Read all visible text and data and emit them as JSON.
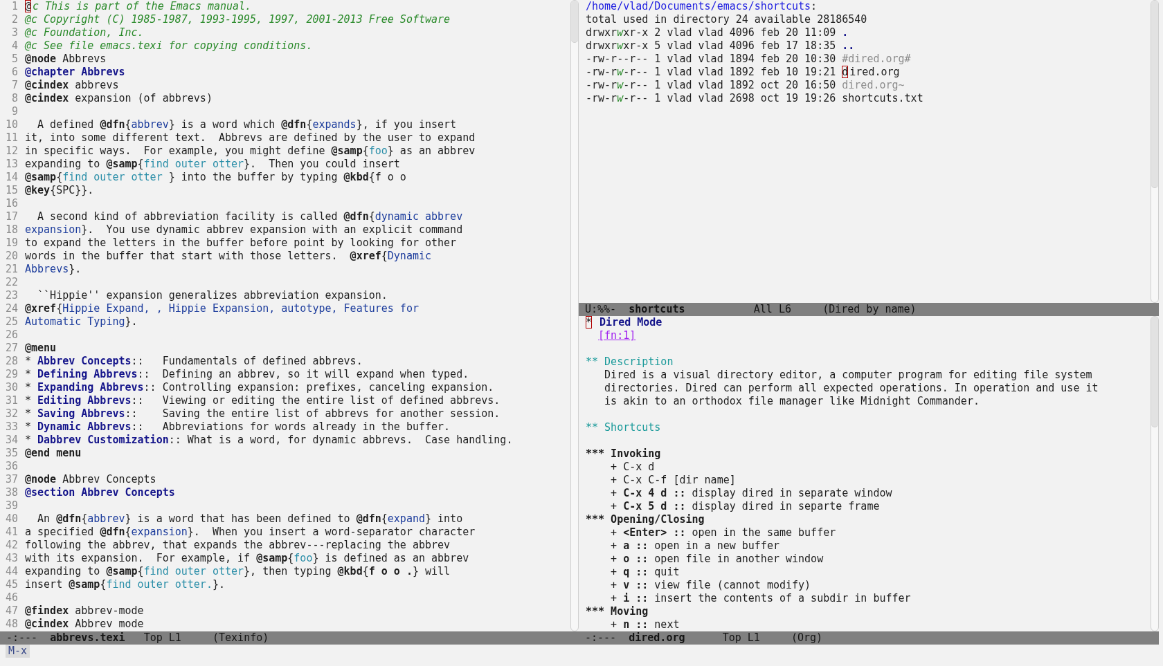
{
  "left_window": {
    "lines": [
      {
        "number": "1",
        "segments": [
          {
            "kind": "cursor",
            "text": "@"
          },
          {
            "kind": "comment",
            "text": "c This is part of the Emacs manual."
          }
        ]
      },
      {
        "number": "2",
        "segments": [
          {
            "kind": "comment",
            "text": "@c Copyright (C) 1985-1987, 1993-1995, 1997, 2001-2013 Free Software"
          }
        ]
      },
      {
        "number": "3",
        "segments": [
          {
            "kind": "comment",
            "text": "@c Foundation, Inc."
          }
        ]
      },
      {
        "number": "4",
        "segments": [
          {
            "kind": "comment",
            "text": "@c See file emacs.texi for copying conditions."
          }
        ]
      },
      {
        "number": "5",
        "segments": [
          {
            "kind": "keyword",
            "text": "@node"
          },
          {
            "kind": "plain",
            "text": " Abbrevs"
          }
        ]
      },
      {
        "number": "6",
        "segments": [
          {
            "kind": "heading",
            "text": "@chapter Abbrevs"
          }
        ]
      },
      {
        "number": "7",
        "segments": [
          {
            "kind": "keyword",
            "text": "@cindex"
          },
          {
            "kind": "plain",
            "text": " abbrevs"
          }
        ]
      },
      {
        "number": "8",
        "segments": [
          {
            "kind": "keyword",
            "text": "@cindex"
          },
          {
            "kind": "plain",
            "text": " expansion (of abbrevs)"
          }
        ]
      },
      {
        "number": "9"
      },
      {
        "number": "10",
        "segments": [
          {
            "kind": "plain",
            "text": "  A defined "
          },
          {
            "kind": "keyword",
            "text": "@dfn"
          },
          {
            "kind": "plain",
            "text": "{"
          },
          {
            "kind": "link",
            "text": "abbrev"
          },
          {
            "kind": "plain",
            "text": "} is a word which "
          },
          {
            "kind": "keyword",
            "text": "@dfn"
          },
          {
            "kind": "plain",
            "text": "{"
          },
          {
            "kind": "link",
            "text": "expands"
          },
          {
            "kind": "plain",
            "text": "}, if you insert"
          }
        ]
      },
      {
        "number": "11",
        "segments": [
          {
            "kind": "plain",
            "text": "it, into some different text.  Abbrevs are defined by the user to expand"
          }
        ]
      },
      {
        "number": "12",
        "segments": [
          {
            "kind": "plain",
            "text": "in specific ways.  For example, you might define "
          },
          {
            "kind": "keyword",
            "text": "@samp"
          },
          {
            "kind": "plain",
            "text": "{"
          },
          {
            "kind": "sample",
            "text": "foo"
          },
          {
            "kind": "plain",
            "text": "} as an abbrev"
          }
        ]
      },
      {
        "number": "13",
        "segments": [
          {
            "kind": "plain",
            "text": "expanding to "
          },
          {
            "kind": "keyword",
            "text": "@samp"
          },
          {
            "kind": "plain",
            "text": "{"
          },
          {
            "kind": "sample",
            "text": "find outer otter"
          },
          {
            "kind": "plain",
            "text": "}.  Then you could insert"
          }
        ]
      },
      {
        "number": "14",
        "segments": [
          {
            "kind": "keyword",
            "text": "@samp"
          },
          {
            "kind": "plain",
            "text": "{"
          },
          {
            "kind": "sample",
            "text": "find outer otter "
          },
          {
            "kind": "plain",
            "text": "} into the buffer by typing "
          },
          {
            "kind": "keyword",
            "text": "@kbd"
          },
          {
            "kind": "plain",
            "text": "{f o o"
          }
        ]
      },
      {
        "number": "15",
        "segments": [
          {
            "kind": "keyword",
            "text": "@key"
          },
          {
            "kind": "plain",
            "text": "{SPC}}."
          }
        ]
      },
      {
        "number": "16"
      },
      {
        "number": "17",
        "segments": [
          {
            "kind": "plain",
            "text": "  A second kind of abbreviation facility is called "
          },
          {
            "kind": "keyword",
            "text": "@dfn"
          },
          {
            "kind": "plain",
            "text": "{"
          },
          {
            "kind": "link",
            "text": "dynamic abbrev"
          }
        ]
      },
      {
        "number": "18",
        "segments": [
          {
            "kind": "link",
            "text": "expansion"
          },
          {
            "kind": "plain",
            "text": "}.  You use dynamic abbrev expansion with an explicit command"
          }
        ]
      },
      {
        "number": "19",
        "segments": [
          {
            "kind": "plain",
            "text": "to expand the letters in the buffer before point by looking for other"
          }
        ]
      },
      {
        "number": "20",
        "segments": [
          {
            "kind": "plain",
            "text": "words in the buffer that start with those letters.  "
          },
          {
            "kind": "keyword",
            "text": "@xref"
          },
          {
            "kind": "plain",
            "text": "{"
          },
          {
            "kind": "link",
            "text": "Dynamic"
          }
        ]
      },
      {
        "number": "21",
        "segments": [
          {
            "kind": "link",
            "text": "Abbrevs"
          },
          {
            "kind": "plain",
            "text": "}."
          }
        ]
      },
      {
        "number": "22"
      },
      {
        "number": "23",
        "segments": [
          {
            "kind": "plain",
            "text": "  ``Hippie'' expansion generalizes abbreviation expansion."
          }
        ]
      },
      {
        "number": "24",
        "segments": [
          {
            "kind": "keyword",
            "text": "@xref"
          },
          {
            "kind": "plain",
            "text": "{"
          },
          {
            "kind": "link",
            "text": "Hippie Expand, , Hippie Expansion, autotype, Features for"
          }
        ]
      },
      {
        "number": "25",
        "segments": [
          {
            "kind": "link",
            "text": "Automatic Typing"
          },
          {
            "kind": "plain",
            "text": "}."
          }
        ]
      },
      {
        "number": "26"
      },
      {
        "number": "27",
        "segments": [
          {
            "kind": "keyword",
            "text": "@menu"
          }
        ]
      },
      {
        "number": "28",
        "segments": [
          {
            "kind": "plain",
            "text": "* "
          },
          {
            "kind": "heading",
            "text": "Abbrev Concepts"
          },
          {
            "kind": "plain",
            "text": "::   Fundamentals of defined abbrevs."
          }
        ]
      },
      {
        "number": "29",
        "segments": [
          {
            "kind": "plain",
            "text": "* "
          },
          {
            "kind": "heading",
            "text": "Defining Abbrevs"
          },
          {
            "kind": "plain",
            "text": "::  Defining an abbrev, so it will expand when typed."
          }
        ]
      },
      {
        "number": "30",
        "segments": [
          {
            "kind": "plain",
            "text": "* "
          },
          {
            "kind": "heading",
            "text": "Expanding Abbrevs"
          },
          {
            "kind": "plain",
            "text": ":: Controlling expansion: prefixes, canceling expansion."
          }
        ]
      },
      {
        "number": "31",
        "segments": [
          {
            "kind": "plain",
            "text": "* "
          },
          {
            "kind": "heading",
            "text": "Editing Abbrevs"
          },
          {
            "kind": "plain",
            "text": "::   Viewing or editing the entire list of defined abbrevs."
          }
        ]
      },
      {
        "number": "32",
        "segments": [
          {
            "kind": "plain",
            "text": "* "
          },
          {
            "kind": "heading",
            "text": "Saving Abbrevs"
          },
          {
            "kind": "plain",
            "text": "::    Saving the entire list of abbrevs for another session."
          }
        ]
      },
      {
        "number": "33",
        "segments": [
          {
            "kind": "plain",
            "text": "* "
          },
          {
            "kind": "heading",
            "text": "Dynamic Abbrevs"
          },
          {
            "kind": "plain",
            "text": "::   Abbreviations for words already in the buffer."
          }
        ]
      },
      {
        "number": "34",
        "segments": [
          {
            "kind": "plain",
            "text": "* "
          },
          {
            "kind": "heading",
            "text": "Dabbrev Customization"
          },
          {
            "kind": "plain",
            "text": ":: What is a word, for dynamic abbrevs.  Case handling."
          }
        ]
      },
      {
        "number": "35",
        "segments": [
          {
            "kind": "keyword",
            "text": "@end menu"
          }
        ]
      },
      {
        "number": "36"
      },
      {
        "number": "37",
        "segments": [
          {
            "kind": "keyword",
            "text": "@node"
          },
          {
            "kind": "plain",
            "text": " Abbrev Concepts"
          }
        ]
      },
      {
        "number": "38",
        "segments": [
          {
            "kind": "heading",
            "text": "@section Abbrev Concepts"
          }
        ]
      },
      {
        "number": "39"
      },
      {
        "number": "40",
        "segments": [
          {
            "kind": "plain",
            "text": "  An "
          },
          {
            "kind": "keyword",
            "text": "@dfn"
          },
          {
            "kind": "plain",
            "text": "{"
          },
          {
            "kind": "link",
            "text": "abbrev"
          },
          {
            "kind": "plain",
            "text": "} is a word that has been defined to "
          },
          {
            "kind": "keyword",
            "text": "@dfn"
          },
          {
            "kind": "plain",
            "text": "{"
          },
          {
            "kind": "link",
            "text": "expand"
          },
          {
            "kind": "plain",
            "text": "} into"
          }
        ]
      },
      {
        "number": "41",
        "segments": [
          {
            "kind": "plain",
            "text": "a specified "
          },
          {
            "kind": "keyword",
            "text": "@dfn"
          },
          {
            "kind": "plain",
            "text": "{"
          },
          {
            "kind": "link",
            "text": "expansion"
          },
          {
            "kind": "plain",
            "text": "}.  When you insert a word-separator character"
          }
        ]
      },
      {
        "number": "42",
        "segments": [
          {
            "kind": "plain",
            "text": "following the abbrev, that expands the abbrev---replacing the abbrev"
          }
        ]
      },
      {
        "number": "43",
        "segments": [
          {
            "kind": "plain",
            "text": "with its expansion.  For example, if "
          },
          {
            "kind": "keyword",
            "text": "@samp"
          },
          {
            "kind": "plain",
            "text": "{"
          },
          {
            "kind": "sample",
            "text": "foo"
          },
          {
            "kind": "plain",
            "text": "} is defined as an abbrev"
          }
        ]
      },
      {
        "number": "44",
        "segments": [
          {
            "kind": "plain",
            "text": "expanding to "
          },
          {
            "kind": "keyword",
            "text": "@samp"
          },
          {
            "kind": "plain",
            "text": "{"
          },
          {
            "kind": "sample",
            "text": "find outer otter"
          },
          {
            "kind": "plain",
            "text": "}, then typing "
          },
          {
            "kind": "keyword",
            "text": "@kbd"
          },
          {
            "kind": "plain",
            "text": "{"
          },
          {
            "kind": "keyword",
            "text": "f o o ."
          },
          {
            "kind": "plain",
            "text": "} will"
          }
        ]
      },
      {
        "number": "45",
        "segments": [
          {
            "kind": "plain",
            "text": "insert "
          },
          {
            "kind": "keyword",
            "text": "@samp"
          },
          {
            "kind": "plain",
            "text": "{"
          },
          {
            "kind": "sample",
            "text": "find outer otter."
          },
          {
            "kind": "plain",
            "text": "}."
          }
        ]
      },
      {
        "number": "46"
      },
      {
        "number": "47",
        "segments": [
          {
            "kind": "keyword",
            "text": "@findex"
          },
          {
            "kind": "plain",
            "text": " abbrev-mode"
          }
        ]
      },
      {
        "number": "48",
        "segments": [
          {
            "kind": "keyword",
            "text": "@cindex"
          },
          {
            "kind": "plain",
            "text": " Abbrev mode"
          }
        ]
      }
    ],
    "mode_line": {
      "status": "-:---",
      "buffer": "abbrevs.texi",
      "position": "Top L1",
      "mode": "(Texinfo)"
    }
  },
  "dired_window": {
    "lines": [
      {
        "segments": [
          {
            "kind": "path",
            "text": "/home/vlad/Documents/emacs/shortcuts"
          },
          {
            "kind": "plain",
            "text": ":"
          }
        ]
      },
      {
        "segments": [
          {
            "kind": "plain",
            "text": "total used in directory 24 available 28186540"
          }
        ]
      },
      {
        "segments": [
          {
            "kind": "plain",
            "text": "drwxr"
          },
          {
            "kind": "permission",
            "text": "w"
          },
          {
            "kind": "plain",
            "text": "xr-x 2 vlad vlad 4096 feb 20 11:09 "
          },
          {
            "kind": "directory",
            "text": "."
          }
        ]
      },
      {
        "segments": [
          {
            "kind": "plain",
            "text": "drwxr"
          },
          {
            "kind": "permission",
            "text": "w"
          },
          {
            "kind": "plain",
            "text": "xr-x 5 vlad vlad 4096 feb 17 18:35 "
          },
          {
            "kind": "directory",
            "text": ".."
          }
        ]
      },
      {
        "segments": [
          {
            "kind": "plain",
            "text": "-rw-r--r-- 1 vlad vlad 1894 feb 20 10:30 "
          },
          {
            "kind": "ignored",
            "text": "#dired.org#"
          }
        ]
      },
      {
        "segments": [
          {
            "kind": "plain",
            "text": "-rw-r"
          },
          {
            "kind": "permission",
            "text": "w"
          },
          {
            "kind": "plain",
            "text": "-r-- 1 vlad vlad 1892 feb 10 19:21 "
          },
          {
            "kind": "cursor",
            "text": "d"
          },
          {
            "kind": "plain",
            "text": "ired.org"
          }
        ]
      },
      {
        "segments": [
          {
            "kind": "plain",
            "text": "-rw-r"
          },
          {
            "kind": "permission",
            "text": "w"
          },
          {
            "kind": "plain",
            "text": "-r-- 1 vlad vlad 1892 oct 20 16:50 "
          },
          {
            "kind": "ignored",
            "text": "dired.org~"
          }
        ]
      },
      {
        "segments": [
          {
            "kind": "plain",
            "text": "-rw-r"
          },
          {
            "kind": "permission",
            "text": "w"
          },
          {
            "kind": "plain",
            "text": "-r-- 1 vlad vlad 2698 oct 19 19:26 shortcuts.txt"
          }
        ]
      }
    ],
    "mode_line": {
      "status": "U:%%-",
      "buffer": "shortcuts",
      "position": "All L6",
      "mode": "(Dired by name)"
    }
  },
  "org_window": {
    "lines": [
      {
        "kind": "text",
        "segments": [
          {
            "kind": "cursor",
            "text": "*"
          },
          {
            "kind": "heading",
            "text": " Dired Mode"
          }
        ]
      },
      {
        "kind": "footnote",
        "segments": [
          {
            "kind": "footnote",
            "text": "[fn:1]"
          }
        ]
      },
      {
        "kind": "blank"
      },
      {
        "kind": "text",
        "segments": [
          {
            "kind": "subheading",
            "text": "** Description"
          }
        ]
      },
      {
        "kind": "text",
        "segments": [
          {
            "kind": "plain",
            "text": "   Dired is a visual directory editor, a computer program for editing file system"
          }
        ]
      },
      {
        "kind": "text",
        "segments": [
          {
            "kind": "plain",
            "text": "   directories. Dired can perform all expected operations. In operation and use it"
          }
        ]
      },
      {
        "kind": "text",
        "segments": [
          {
            "kind": "plain",
            "text": "   is akin to an orthodox file manager like Midnight Commander."
          }
        ]
      },
      {
        "kind": "blank"
      },
      {
        "kind": "text",
        "segments": [
          {
            "kind": "subheading",
            "text": "** Shortcuts"
          }
        ]
      },
      {
        "kind": "blank"
      },
      {
        "kind": "text",
        "segments": [
          {
            "kind": "keyword",
            "text": "*** Invoking"
          }
        ]
      },
      {
        "kind": "text",
        "segments": [
          {
            "kind": "plain",
            "text": "    + C-x d"
          }
        ]
      },
      {
        "kind": "text",
        "segments": [
          {
            "kind": "plain",
            "text": "    + C-x C-f [dir name]"
          }
        ]
      },
      {
        "kind": "text",
        "segments": [
          {
            "kind": "plain",
            "text": "    + "
          },
          {
            "kind": "keyword",
            "text": "C-x 4 d ::"
          },
          {
            "kind": "plain",
            "text": " display dired in separate window"
          }
        ]
      },
      {
        "kind": "text",
        "segments": [
          {
            "kind": "plain",
            "text": "    + "
          },
          {
            "kind": "keyword",
            "text": "C-x 5 d ::"
          },
          {
            "kind": "plain",
            "text": " display dired in separte frame"
          }
        ]
      },
      {
        "kind": "text",
        "segments": [
          {
            "kind": "keyword",
            "text": "*** Opening/Closing"
          }
        ]
      },
      {
        "kind": "text",
        "segments": [
          {
            "kind": "plain",
            "text": "    + "
          },
          {
            "kind": "keyword",
            "text": "<Enter> ::"
          },
          {
            "kind": "plain",
            "text": " open in the same buffer"
          }
        ]
      },
      {
        "kind": "text",
        "segments": [
          {
            "kind": "plain",
            "text": "    + "
          },
          {
            "kind": "keyword",
            "text": "a ::"
          },
          {
            "kind": "plain",
            "text": " open in a new buffer"
          }
        ]
      },
      {
        "kind": "text",
        "segments": [
          {
            "kind": "plain",
            "text": "    + "
          },
          {
            "kind": "keyword",
            "text": "o ::"
          },
          {
            "kind": "plain",
            "text": " open file in another window"
          }
        ]
      },
      {
        "kind": "text",
        "segments": [
          {
            "kind": "plain",
            "text": "    + "
          },
          {
            "kind": "keyword",
            "text": "q ::"
          },
          {
            "kind": "plain",
            "text": " quit"
          }
        ]
      },
      {
        "kind": "text",
        "segments": [
          {
            "kind": "plain",
            "text": "    + "
          },
          {
            "kind": "keyword",
            "text": "v ::"
          },
          {
            "kind": "plain",
            "text": " view file (cannot modify)"
          }
        ]
      },
      {
        "kind": "text",
        "segments": [
          {
            "kind": "plain",
            "text": "    + "
          },
          {
            "kind": "keyword",
            "text": "i ::"
          },
          {
            "kind": "plain",
            "text": " insert the contents of a subdir in buffer"
          }
        ]
      },
      {
        "kind": "text",
        "segments": [
          {
            "kind": "keyword",
            "text": "*** Moving"
          }
        ]
      },
      {
        "kind": "text",
        "segments": [
          {
            "kind": "plain",
            "text": "    + "
          },
          {
            "kind": "keyword",
            "text": "n ::"
          },
          {
            "kind": "plain",
            "text": " next"
          }
        ]
      }
    ],
    "mode_line": {
      "status": "-:---",
      "buffer": "dired.org",
      "position": "Top L1",
      "mode": "(Org)"
    }
  },
  "minibuffer": {
    "prompt": "M-x"
  }
}
